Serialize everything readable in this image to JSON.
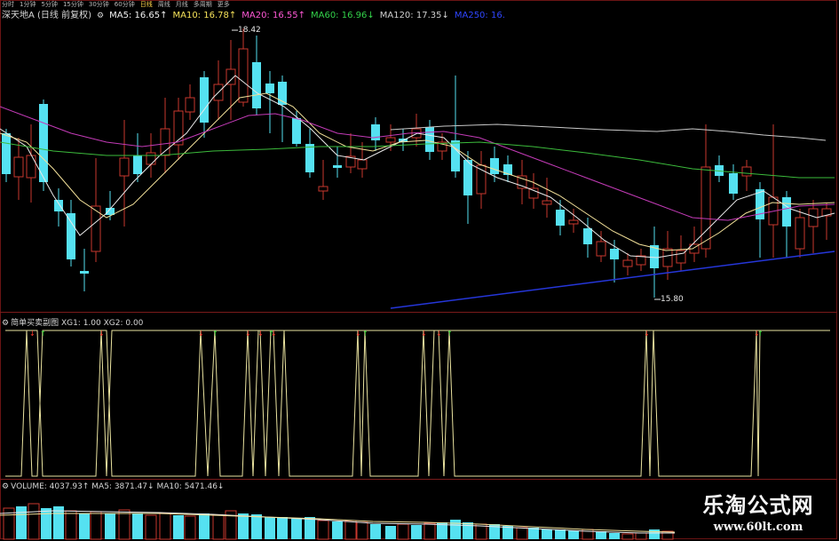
{
  "toolbar": {
    "items": [
      {
        "label": "分时",
        "active": false
      },
      {
        "label": "1分钟",
        "active": false
      },
      {
        "label": "5分钟",
        "active": false
      },
      {
        "label": "15分钟",
        "active": false
      },
      {
        "label": "30分钟",
        "active": false
      },
      {
        "label": "60分钟",
        "active": false
      },
      {
        "label": "日线",
        "active": true
      },
      {
        "label": "周线",
        "active": false
      },
      {
        "label": "月线",
        "active": false
      },
      {
        "label": "多周期",
        "active": false
      },
      {
        "label": "更多",
        "active": false
      }
    ]
  },
  "main": {
    "stock_title": "深天地A (日线 前复权)",
    "ma5_label": "MA5: 16.65↑",
    "ma10_label": "MA10: 16.78↑",
    "ma20_label": "MA20: 16.55↑",
    "ma60_label": "MA60: 16.96↓",
    "ma120_label": "MA120: 17.35↓",
    "ma250_label": "MA250: 16.",
    "high_label": "18.42",
    "low_label": "15.80"
  },
  "indicator": {
    "title": "简单买卖副图  XG1: 1.00  XG2: 0.00"
  },
  "volume": {
    "title": "VOLUME: 4037.93↑  MA5: 3871.47↓  MA10: 5471.46↓"
  },
  "colors": {
    "up_candle": "#c9382e",
    "down_candle": "#55e1f1",
    "ma5": "#e9e9e9",
    "ma10": "#f3e19a",
    "ma20": "#c43bb8",
    "ma60": "#3cbb3c",
    "ma120": "#c9c9c9",
    "trendline": "#2536d9",
    "indicator_line": "#eae3a0"
  },
  "watermark": {
    "text_cn": "乐淘公式网",
    "text_url": "www.60lt.com"
  }
}
